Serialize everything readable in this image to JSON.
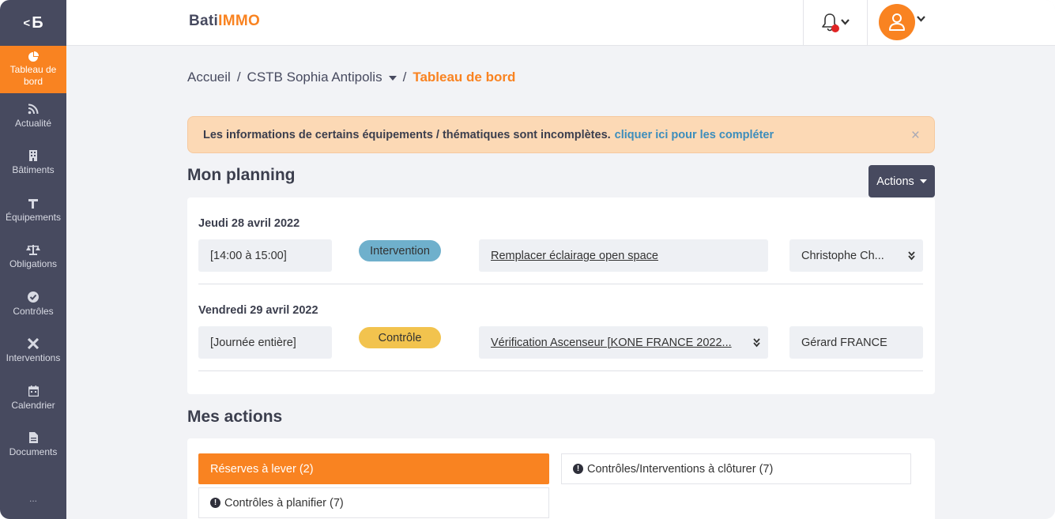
{
  "sidebar": {
    "logo": "Б",
    "items": [
      {
        "label": "Tableau de bord",
        "icon": "pie-chart-icon"
      },
      {
        "label": "Actualité",
        "icon": "rss-icon"
      },
      {
        "label": "Bâtiments",
        "icon": "building-icon"
      },
      {
        "label": "Équipements",
        "icon": "equipment-icon"
      },
      {
        "label": "Obligations",
        "icon": "balance-scale-icon"
      },
      {
        "label": "Contrôles",
        "icon": "check-circle-icon"
      },
      {
        "label": "Interventions",
        "icon": "tools-icon"
      },
      {
        "label": "Calendrier",
        "icon": "calendar-icon"
      },
      {
        "label": "Documents",
        "icon": "document-icon"
      }
    ],
    "more": "..."
  },
  "header": {
    "brand_part1": "Bati",
    "brand_part2": "IMMO"
  },
  "breadcrumb": {
    "home": "Accueil",
    "site": "CSTB Sophia Antipolis",
    "current": "Tableau de bord"
  },
  "alert": {
    "text": "Les informations de certains équipements / thématiques sont incomplètes.",
    "link": "cliquer ici pour les compléter",
    "close": "×"
  },
  "planning": {
    "title": "Mon planning",
    "actions_label": "Actions",
    "days": [
      {
        "date": "Jeudi 28 avril 2022",
        "time": "[14:00 à 15:00]",
        "badge": "Intervention",
        "task": "Remplacer éclairage open space",
        "person": "Christophe Ch..."
      },
      {
        "date": "Vendredi 29 avril 2022",
        "time": "[Journée entière]",
        "badge": "Contrôle",
        "task": "Vérification Ascenseur [KONE FRANCE 2022...",
        "person": "Gérard FRANCE"
      }
    ]
  },
  "mes_actions": {
    "title": "Mes actions",
    "tabs": [
      {
        "label": "Réserves à lever (2)"
      },
      {
        "label": "Contrôles/Interventions à clôturer (7)"
      },
      {
        "label": "Contrôles à planifier (7)"
      }
    ]
  },
  "colors": {
    "sidebar": "#474a5f",
    "accent": "#f98321",
    "intervention_badge": "#6fb0cc",
    "controle_badge": "#f2c34e"
  }
}
